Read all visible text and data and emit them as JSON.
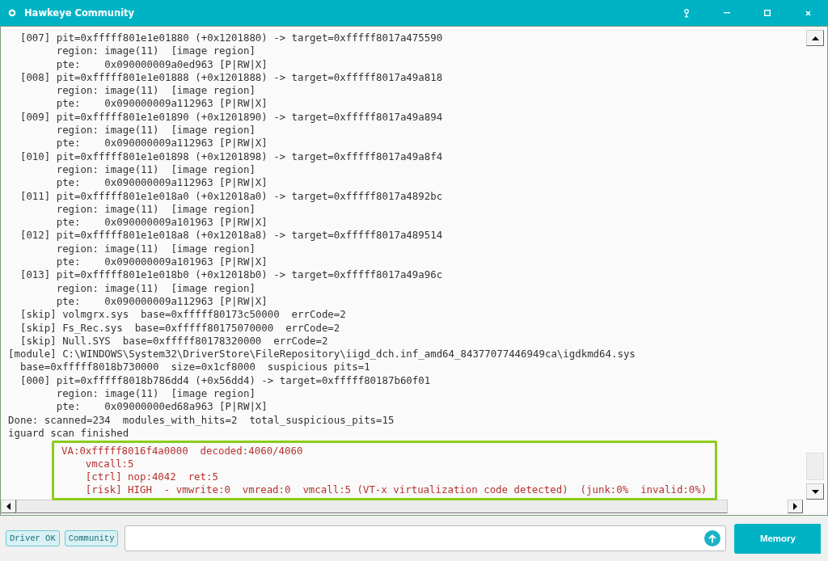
{
  "window": {
    "title": "Hawkeye Community"
  },
  "log": {
    "lines": [
      "  [007] pit=0xfffff801e1e01880 (+0x1201880) -> target=0xfffff8017a475590",
      "        region: image(11)  [image region]",
      "        pte:    0x090000009a0ed963 [P|RW|X]",
      "  [008] pit=0xfffff801e1e01888 (+0x1201888) -> target=0xfffff8017a49a818",
      "        region: image(11)  [image region]",
      "        pte:    0x090000009a112963 [P|RW|X]",
      "  [009] pit=0xfffff801e1e01890 (+0x1201890) -> target=0xfffff8017a49a894",
      "        region: image(11)  [image region]",
      "        pte:    0x090000009a112963 [P|RW|X]",
      "  [010] pit=0xfffff801e1e01898 (+0x1201898) -> target=0xfffff8017a49a8f4",
      "        region: image(11)  [image region]",
      "        pte:    0x090000009a112963 [P|RW|X]",
      "  [011] pit=0xfffff801e1e018a0 (+0x12018a0) -> target=0xfffff8017a4892bc",
      "        region: image(11)  [image region]",
      "        pte:    0x090000009a101963 [P|RW|X]",
      "  [012] pit=0xfffff801e1e018a8 (+0x12018a8) -> target=0xfffff8017a489514",
      "        region: image(11)  [image region]",
      "        pte:    0x090000009a101963 [P|RW|X]",
      "  [013] pit=0xfffff801e1e018b0 (+0x12018b0) -> target=0xfffff8017a49a96c",
      "        region: image(11)  [image region]",
      "        pte:    0x090000009a112963 [P|RW|X]",
      "  [skip] volmgrx.sys  base=0xfffff80173c50000  errCode=2",
      "  [skip] Fs_Rec.sys  base=0xfffff80175070000  errCode=2",
      "  [skip] Null.SYS  base=0xfffff80178320000  errCode=2",
      "[module] C:\\WINDOWS\\System32\\DriverStore\\FileRepository\\iigd_dch.inf_amd64_84377077446949ca\\igdkmd64.sys",
      "  base=0xfffff8018b730000  size=0x1cf8000  suspicious pits=1",
      "  [000] pit=0xfffff8018b786dd4 (+0x56dd4) -> target=0xfffff80187b60f01",
      "        region: image(11)  [image region]",
      "        pte:    0x09000000ed68a963 [P|RW|X]",
      "Done: scanned=234  modules_with_hits=2  total_suspicious_pits=15",
      "iguard scan finished"
    ]
  },
  "highlight": {
    "lines": [
      "VA:0xfffff8016f4a0000  decoded:4060/4060",
      "    vmcall:5",
      "    [ctrl] nop:4042  ret:5",
      "    [risk] HIGH  - vmwrite:0  vmread:0  vmcall:5 (VT-x virtualization code detected)  (junk:0%  invalid:0%)"
    ]
  },
  "footer": {
    "badges": [
      "Driver OK",
      "Community"
    ],
    "button": "Memory"
  }
}
